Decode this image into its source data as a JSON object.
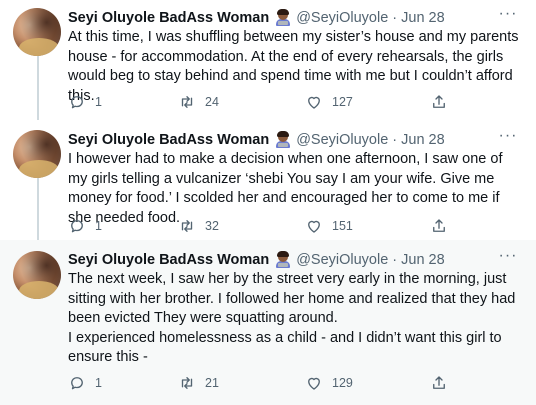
{
  "tweets": [
    {
      "name": "Seyi Oluyole BadAss Woman",
      "handle": "@SeyiOluyole",
      "date": "Jun 28",
      "text": "At this time, I was shuffling between my sister’s house and my parents house - for accommodation. At the end of every rehearsals, the girls would beg to stay behind and spend time with me but I couldn’t afford this.",
      "replies": "1",
      "retweets": "24",
      "likes": "127"
    },
    {
      "name": "Seyi Oluyole BadAss Woman",
      "handle": "@SeyiOluyole",
      "date": "Jun 28",
      "text": "I however had to make a decision when one afternoon, I saw one of my girls telling a vulcanizer ‘shebi You say I am your wife. Give me money for food.’ I scolded her and encouraged her to come to me if she needed food.",
      "replies": "1",
      "retweets": "32",
      "likes": "151"
    },
    {
      "name": "Seyi Oluyole BadAss Woman",
      "handle": "@SeyiOluyole",
      "date": "Jun 28",
      "text": "The next week, I saw her by the street very early in the morning, just sitting with her brother. I followed her home and realized that they had been evicted They were squatting around.\nI experienced homelessness as a child - and I didn’t want this girl to ensure this -",
      "replies": "1",
      "retweets": "21",
      "likes": "129"
    }
  ],
  "separator_dot": "·",
  "colors": {
    "text": "#0f1419",
    "secondary": "#536471",
    "thread_line": "#cfd9de",
    "highlight_bg": "#f7f9f9"
  }
}
